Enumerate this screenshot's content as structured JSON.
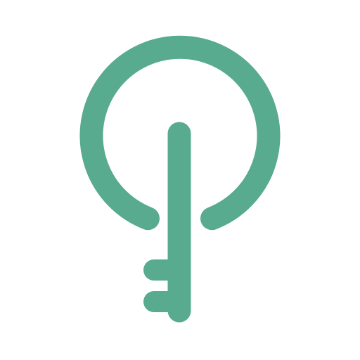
{
  "logo": {
    "icon": "key-power-icon",
    "accent_color": "#58AB8E",
    "background_color": "#FFFFFF"
  }
}
